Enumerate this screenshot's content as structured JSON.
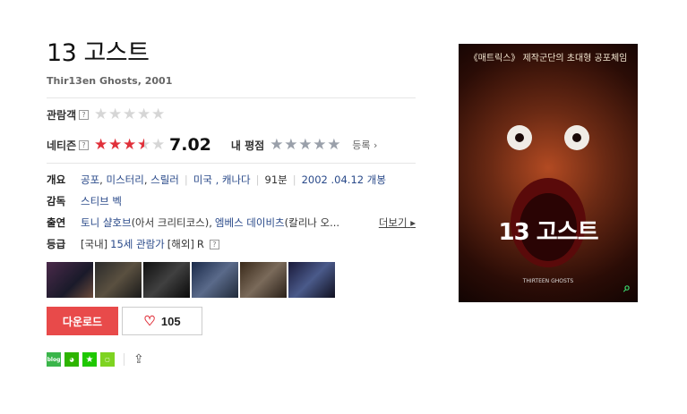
{
  "movie": {
    "title": "13 고스트",
    "subtitle": "Thir13en Ghosts, 2001"
  },
  "ratings": {
    "audience_label": "관람객",
    "netizen_label": "네티즌",
    "netizen_score": "7.02",
    "netizen_stars_fraction": 0.7,
    "my_label": "내 평점",
    "register_label": "등록",
    "help_glyph": "?"
  },
  "info": {
    "overview_label": "개요",
    "genres": [
      "공포",
      "미스터리",
      "스릴러"
    ],
    "countries": "미국 , 캐나다",
    "runtime": "91분",
    "release": "2002 .04.12 개봉",
    "director_label": "감독",
    "director": "스티브 벡",
    "cast_label": "출연",
    "cast_link1": "토니 샬호브",
    "cast_role1": "(아서 크리티코스),",
    "cast_link2": "엠베스 데이비츠",
    "cast_role2": "(칼리나 오...",
    "more_label": "더보기",
    "grade_label": "등급",
    "grade_domestic_prefix": "[국내]",
    "grade_domestic": "15세 관람가",
    "grade_foreign_prefix": "[해외]",
    "grade_foreign": "R"
  },
  "buttons": {
    "download_label": "다운로드",
    "like_count": "105"
  },
  "share": {
    "blog_label": "blog"
  },
  "poster": {
    "tagline": "《매트릭스》 제작군단의 초대형 공포체임",
    "title": "13 고스트",
    "subtitle": "THIRTEEN GHOSTS"
  },
  "colors": {
    "accent_red": "#e84a4a",
    "link_blue": "#2a4a8a",
    "share_green": "#3ab54a"
  }
}
